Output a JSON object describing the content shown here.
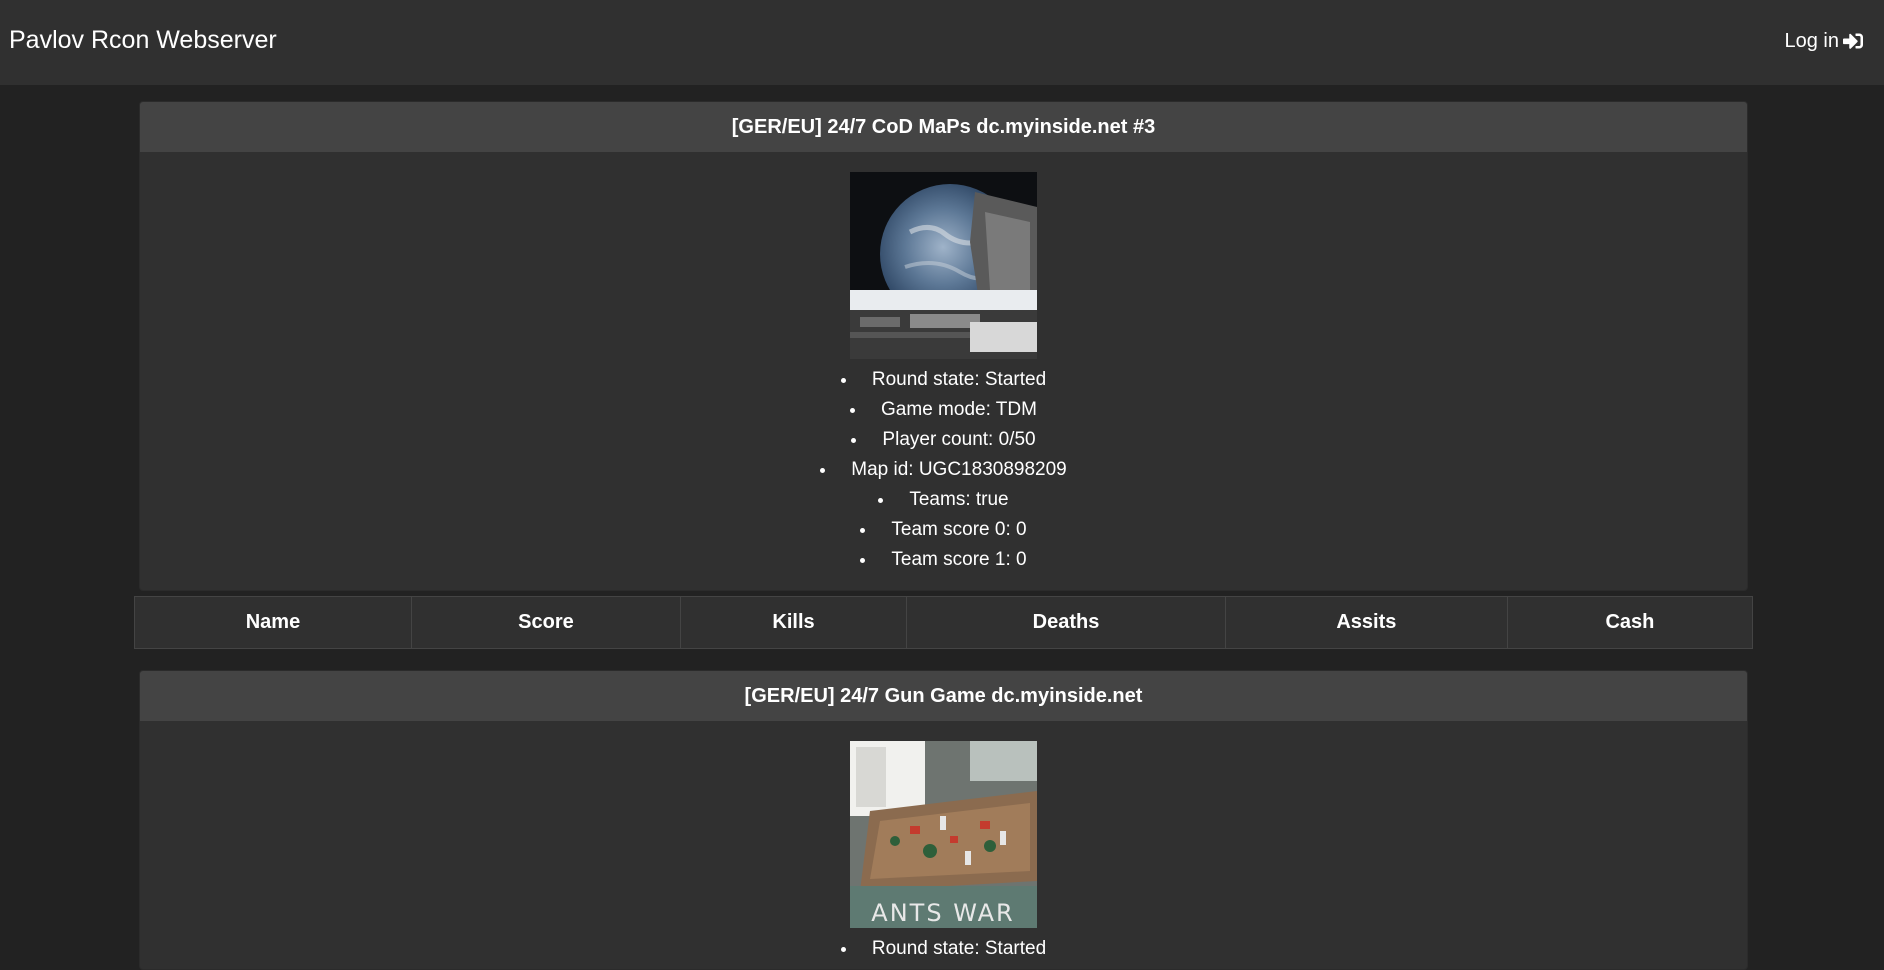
{
  "navbar": {
    "brand": "Pavlov Rcon Webserver",
    "login_label": "Log in"
  },
  "servers": [
    {
      "name": "[GER/EU] 24/7 CoD MaPs dc.myinside.net #3",
      "map_image_alt": "space station map with earth",
      "info": [
        "Round state: Started",
        "Game mode: TDM",
        "Player count: 0/50",
        "Map id: UGC1830898209",
        "Teams: true",
        "Team score 0: 0",
        "Team score 1: 0"
      ],
      "table_headers": [
        "Name",
        "Score",
        "Kills",
        "Deaths",
        "Assits",
        "Cash"
      ]
    },
    {
      "name": "[GER/EU] 24/7 Gun Game dc.myinside.net",
      "map_image_caption": "ANTS WAR",
      "info_partial": "Round state: Started"
    }
  ]
}
